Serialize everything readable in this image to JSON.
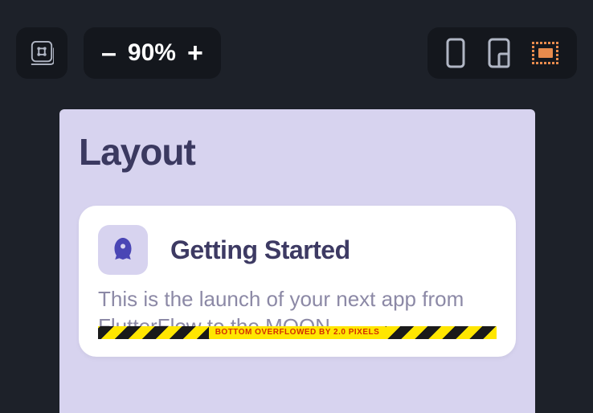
{
  "toolbar": {
    "zoom_value": "90%",
    "zoom_minus": "–",
    "zoom_plus": "+"
  },
  "page": {
    "title": "Layout"
  },
  "card": {
    "title": "Getting Started",
    "body": "This is the launch of your next app from FlutterFlow to the MOON."
  },
  "overflow": {
    "label": "BOTTOM OVERFLOWED BY 2.0 PIXELS"
  }
}
